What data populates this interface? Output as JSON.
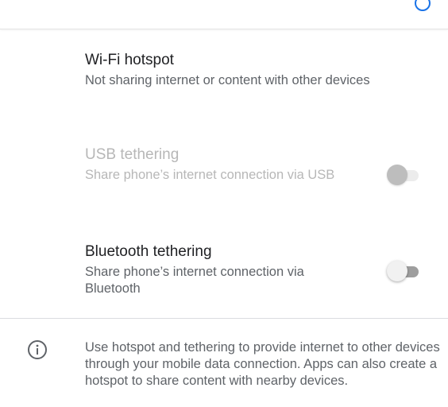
{
  "colors": {
    "accent": "#1a73e8",
    "title_text": "#202124",
    "summary_text": "#5f6368",
    "disabled_text": "#b7b7b7"
  },
  "settings": [
    {
      "title": "Wi-Fi hotspot",
      "summary": "Not sharing internet or content with other devices"
    },
    {
      "title": "USB tethering",
      "summary": "Share phone’s internet connection via USB",
      "enabled": false,
      "switch_on": false
    },
    {
      "title": "Bluetooth tethering",
      "summary": "Share phone’s internet connection via Bluetooth",
      "enabled": true,
      "switch_on": false
    }
  ],
  "footer": {
    "icon": "info-icon",
    "text": "Use hotspot and tethering to provide internet to other devices through your mobile data connection. Apps can also create a hotspot to share content with nearby devices."
  }
}
